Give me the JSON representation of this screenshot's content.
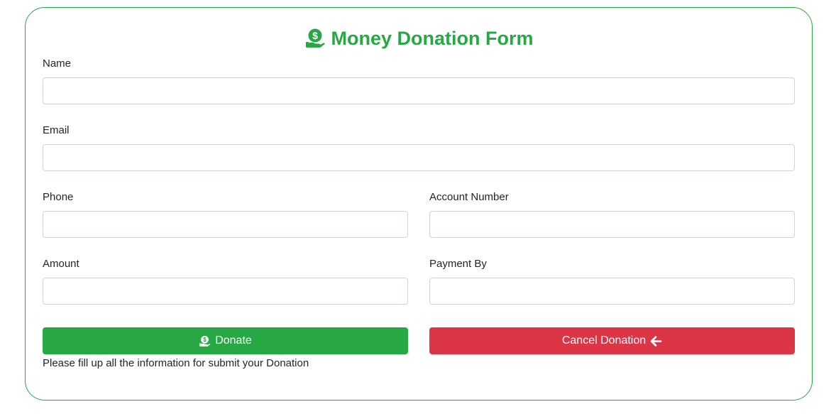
{
  "form": {
    "title": "Money Donation Form",
    "title_icon": "hand-holding-dollar-icon",
    "fields": {
      "name": {
        "label": "Name",
        "value": "",
        "placeholder": ""
      },
      "email": {
        "label": "Email",
        "value": "",
        "placeholder": ""
      },
      "phone": {
        "label": "Phone",
        "value": "",
        "placeholder": ""
      },
      "account_number": {
        "label": "Account Number",
        "value": "",
        "placeholder": ""
      },
      "amount": {
        "label": "Amount",
        "value": "",
        "placeholder": ""
      },
      "payment_by": {
        "label": "Payment By",
        "value": "",
        "placeholder": ""
      }
    },
    "buttons": {
      "donate_label": "Donate",
      "donate_icon": "hand-holding-dollar-icon",
      "cancel_label": "Cancel Donation",
      "cancel_icon": "arrow-left-icon"
    },
    "helper_text": "Please fill up all the information for submit your Donation"
  },
  "colors": {
    "accent_green": "#28a745",
    "danger_red": "#dc3545",
    "input_border": "#ced4da"
  }
}
